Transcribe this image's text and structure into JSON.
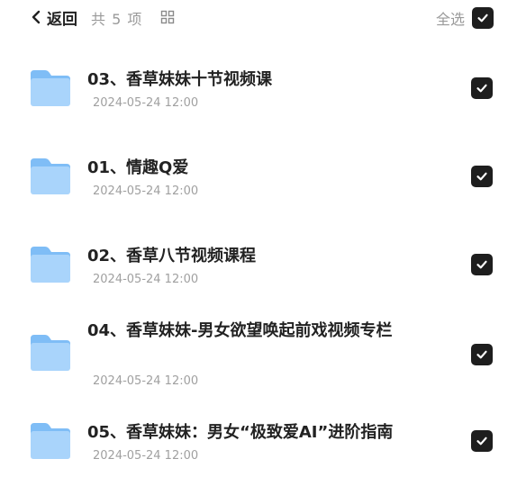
{
  "header": {
    "back_label": "返回",
    "count_label": "共 5 项",
    "select_all_label": "全选"
  },
  "items": [
    {
      "title": "03、香草妹妹十节视频课",
      "date": "2024-05-24 12:00",
      "checked": true
    },
    {
      "title": "01、情趣Q爱",
      "date": "2024-05-24 12:00",
      "checked": true
    },
    {
      "title": "02、香草八节视频课程",
      "date": "2024-05-24 12:00",
      "checked": true
    },
    {
      "title": "04、香草妹妹-男女欲望唤起前戏视频专栏",
      "date": "2024-05-24 12:00",
      "checked": true
    },
    {
      "title": "05、香草妹妹：男女“极致爱AI”进阶指南",
      "date": "2024-05-24 12:00",
      "checked": true
    }
  ],
  "icons": {
    "back": "chevron-left-icon",
    "view": "grid-view-icon",
    "folder": "folder-icon",
    "check": "check-icon"
  },
  "colors": {
    "checkbox": "#1e1e1e",
    "folder_light": "#a9d4fb",
    "folder_dark": "#7fbdf6",
    "muted_text": "#9a9a9a"
  }
}
